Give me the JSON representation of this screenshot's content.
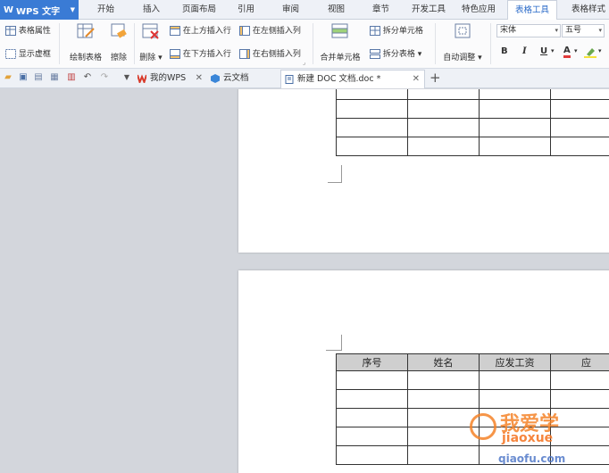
{
  "app": {
    "name": "WPS 文字",
    "logo_letter": "W"
  },
  "menu": {
    "tabs": [
      "开始",
      "插入",
      "页面布局",
      "引用",
      "审阅",
      "视图",
      "章节",
      "开发工具",
      "特色应用",
      "表格工具",
      "表格样式"
    ],
    "active": "表格工具"
  },
  "ribbon": {
    "table_props": "表格属性",
    "show_gridlines": "显示虚框",
    "draw_table": "绘制表格",
    "erase": "擦除",
    "delete": "删除",
    "insert_above": "在上方插入行",
    "insert_below": "在下方插入行",
    "insert_left": "在左侧插入列",
    "insert_right": "在右侧插入列",
    "merge_cells": "合并单元格",
    "split_cells": "拆分单元格",
    "split_table": "拆分表格",
    "auto_fit": "自动调整",
    "font_name": "宋体",
    "font_size": "五号",
    "bold": "B",
    "italic": "I",
    "underline": "U",
    "font_color": "A"
  },
  "tabs": {
    "items": [
      {
        "label": "我的WPS"
      },
      {
        "label": "云文档"
      },
      {
        "label": "新建 DOC 文档.doc *"
      }
    ],
    "active": "新建 DOC 文档.doc *",
    "add": "+"
  },
  "document": {
    "table_header": [
      "序号",
      "姓名",
      "应发工资",
      "应"
    ]
  },
  "watermark": {
    "line1": "我爱学",
    "line2": "jiaoxue",
    "line3": "qiaofu.com"
  },
  "colors": {
    "accent": "#3a7bd5",
    "active_tab_text": "#2a6ac8",
    "table_header_bg": "#cfcfcf"
  }
}
